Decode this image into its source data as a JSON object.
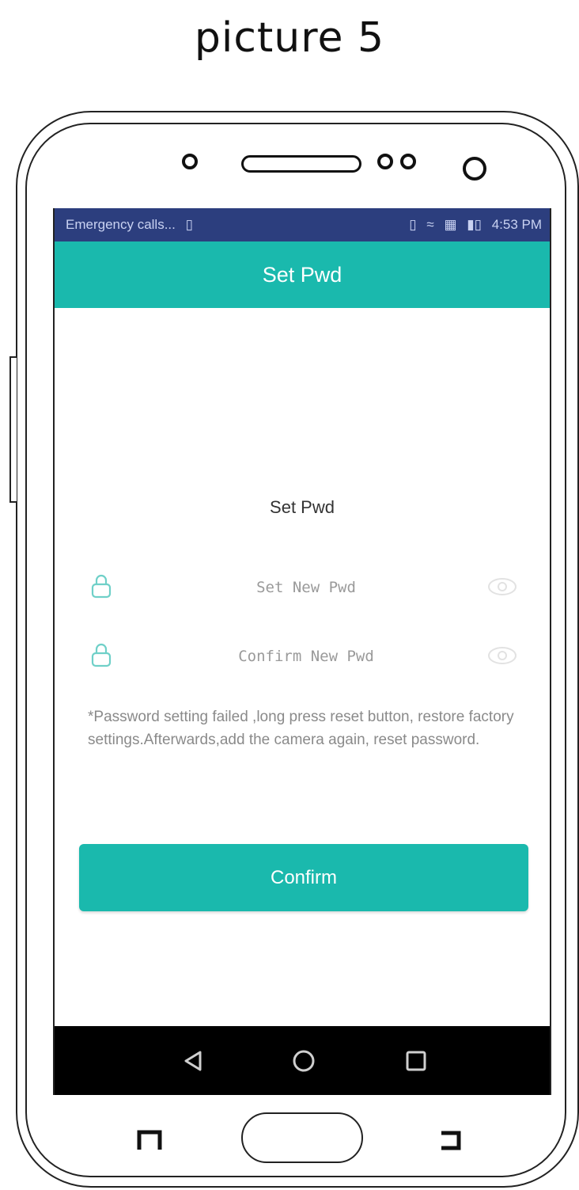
{
  "caption": "picture 5",
  "status_bar": {
    "carrier_text": "Emergency calls...",
    "time": "4:53 PM"
  },
  "app_bar": {
    "title": "Set Pwd"
  },
  "form": {
    "heading": "Set Pwd",
    "new_pwd_placeholder": "Set New Pwd",
    "confirm_pwd_placeholder": "Confirm New Pwd",
    "note": "*Password setting failed ,long press reset button, restore factory settings.Afterwards,add the camera again, reset password.",
    "confirm_label": "Confirm"
  },
  "icons": {
    "field_icon": "lock-icon",
    "visibility_icon": "eye-icon",
    "nav": [
      "back-icon",
      "home-icon",
      "recents-icon"
    ]
  },
  "colors": {
    "accent": "#1ab9ad",
    "status_bar": "#2c3e7e",
    "nav_bar": "#000000",
    "note_text": "#8a8a8a"
  }
}
